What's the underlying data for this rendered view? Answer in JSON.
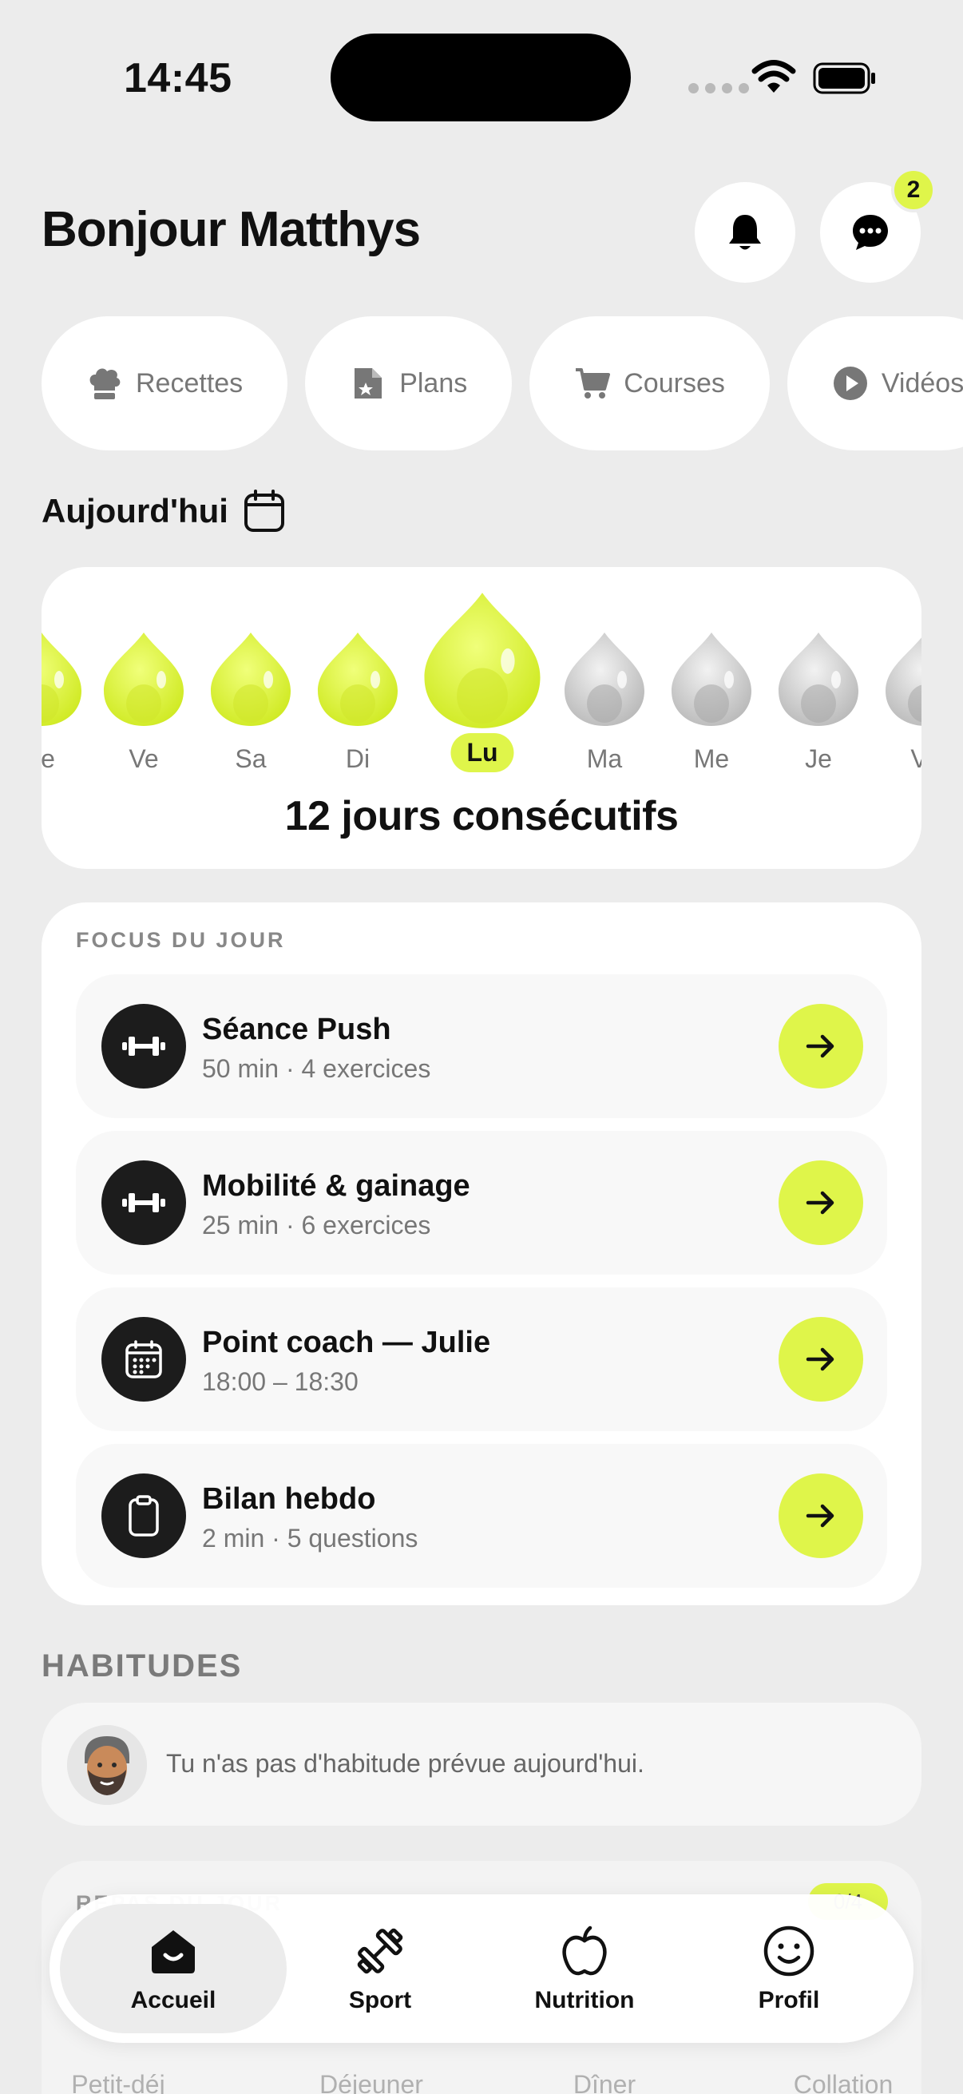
{
  "status": {
    "time": "14:45"
  },
  "header": {
    "greeting": "Bonjour Matthys",
    "messages_badge": "2",
    "icons": [
      "bell-icon",
      "chat-icon"
    ]
  },
  "chips": [
    {
      "label": "Recettes",
      "icon": "chef-hat-icon"
    },
    {
      "label": "Plans",
      "icon": "document-star-icon"
    },
    {
      "label": "Courses",
      "icon": "cart-icon"
    },
    {
      "label": "Vidéos",
      "icon": "play-icon"
    }
  ],
  "today": {
    "title": "Aujourd'hui",
    "days": [
      {
        "label": "Je",
        "state": "done"
      },
      {
        "label": "Ve",
        "state": "done"
      },
      {
        "label": "Sa",
        "state": "done"
      },
      {
        "label": "Di",
        "state": "done"
      },
      {
        "label": "Lu",
        "state": "today"
      },
      {
        "label": "Ma",
        "state": "pending"
      },
      {
        "label": "Me",
        "state": "pending"
      },
      {
        "label": "Je",
        "state": "pending"
      },
      {
        "label": "Ve",
        "state": "pending"
      }
    ],
    "streak_text": "12 jours consécutifs"
  },
  "focus": {
    "title": "FOCUS DU JOUR",
    "tasks": [
      {
        "name": "Séance Push",
        "sub": "50 min · 4 exercices",
        "icon": "dumbbell-icon"
      },
      {
        "name": "Mobilité & gainage",
        "sub": "25 min · 6 exercices",
        "icon": "dumbbell-icon"
      },
      {
        "name": "Point coach — Julie",
        "sub": "18:00 – 18:30",
        "icon": "calendar-icon"
      },
      {
        "name": "Bilan hebdo",
        "sub": "2 min · 5 questions",
        "icon": "clipboard-icon"
      }
    ]
  },
  "habits": {
    "title": "HABITUDES",
    "empty_text": "Tu n'as pas d'habitude prévue aujourd'hui."
  },
  "meals": {
    "title": "REPAS DU JOUR",
    "count": "0/4",
    "items": [
      "Petit-déj",
      "Déjeuner",
      "Dîner",
      "Collation"
    ]
  },
  "tabbar": {
    "tabs": [
      {
        "label": "Accueil",
        "icon": "home-icon",
        "active": true
      },
      {
        "label": "Sport",
        "icon": "dumbbell-icon",
        "active": false
      },
      {
        "label": "Nutrition",
        "icon": "apple-icon",
        "active": false
      },
      {
        "label": "Profil",
        "icon": "smiley-icon",
        "active": false
      }
    ]
  },
  "colors": {
    "accent": "#dff54a",
    "background": "#ececec",
    "card": "#ffffff",
    "dark": "#1c1c1c"
  }
}
